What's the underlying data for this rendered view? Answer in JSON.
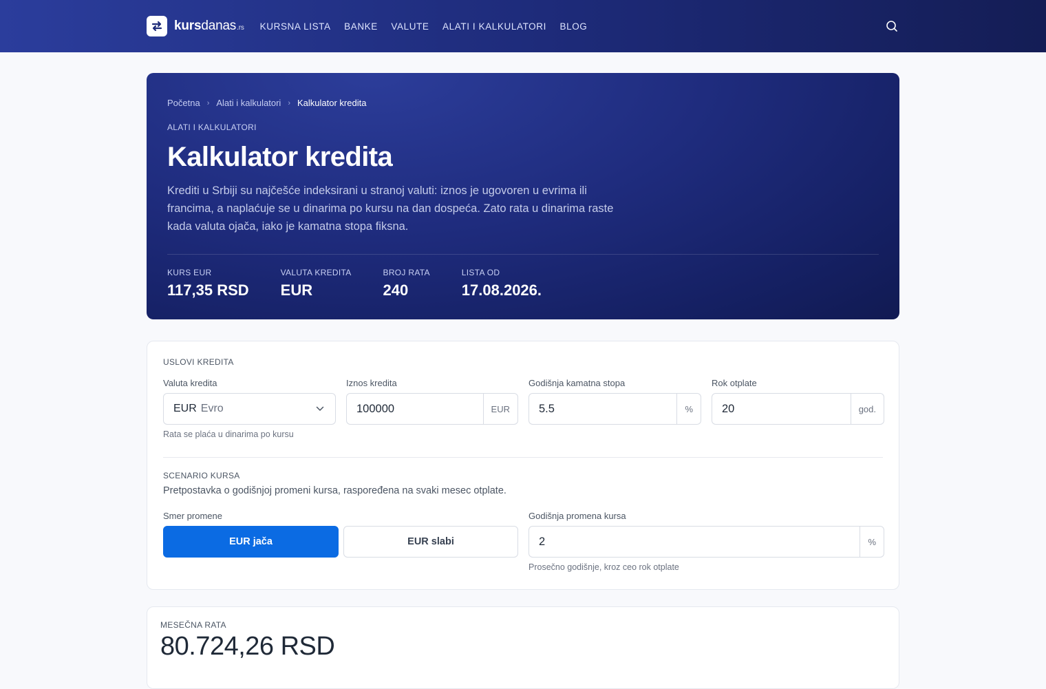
{
  "header": {
    "logo": {
      "bold": "kurs",
      "regular": "danas",
      "tld": ".rs"
    },
    "nav": [
      "KURSNA LISTA",
      "BANKE",
      "VALUTE",
      "ALATI I KALKULATORI",
      "BLOG"
    ]
  },
  "hero": {
    "breadcrumb": [
      "Početna",
      "Alati i kalkulatori",
      "Kalkulator kredita"
    ],
    "eyebrow": "ALATI I KALKULATORI",
    "title": "Kalkulator kredita",
    "description": "Krediti u Srbiji su najčešće indeksirani u stranoj valuti: iznos je ugovoren u evrima ili francima, a naplaćuje se u dinarima po kursu na dan dospeća. Zato rata u dinarima raste kada valuta ojača, iako je kamatna stopa fiksna.",
    "stats": [
      {
        "label": "KURS EUR",
        "value": "117,35 RSD"
      },
      {
        "label": "VALUTA KREDITA",
        "value": "EUR"
      },
      {
        "label": "BROJ RATA",
        "value": "240"
      },
      {
        "label": "LISTA OD",
        "value": "17.08.2026."
      }
    ]
  },
  "conditions": {
    "section_label": "USLOVI KREDITA",
    "currency": {
      "label": "Valuta kredita",
      "code": "EUR",
      "name": "Evro",
      "hint": "Rata se plaća u dinarima po kursu"
    },
    "amount": {
      "label": "Iznos kredita",
      "value": "100000",
      "suffix": "EUR"
    },
    "rate": {
      "label": "Godišnja kamatna stopa",
      "value": "5.5",
      "suffix": "%"
    },
    "term": {
      "label": "Rok otplate",
      "value": "20",
      "suffix": "god."
    }
  },
  "scenario": {
    "section_label": "SCENARIO KURSA",
    "description": "Pretpostavka o godišnjoj promeni kursa, raspoređena na svaki mesec otplate.",
    "direction": {
      "label": "Smer promene",
      "options": [
        "EUR jača",
        "EUR slabi"
      ],
      "selected": "EUR jača"
    },
    "change": {
      "label": "Godišnja promena kursa",
      "value": "2",
      "suffix": "%",
      "hint": "Prosečno godišnje, kroz ceo rok otplate"
    }
  },
  "result": {
    "label": "MESEČNA RATA",
    "value": "80.724,26 RSD"
  },
  "colors": {
    "primary": "#0b6be3",
    "header_bg": "#1d2a78"
  }
}
